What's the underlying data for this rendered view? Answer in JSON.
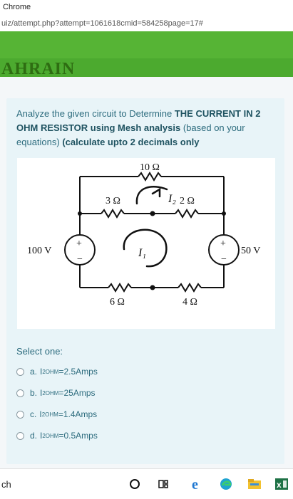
{
  "browser": {
    "title": "Chrome",
    "url": "uiz/attempt.php?attempt=1061618cmid=584258page=17#"
  },
  "banner": {
    "text": "AHRAIN"
  },
  "question": {
    "text_plain": "Analyze the given circuit to Determine ",
    "text_bold_1": "THE CURRENT IN 2 OHM RESISTOR using Mesh analysis",
    "text_plain_2": " (based on your equations) ",
    "text_bold_2": "(calculate upto 2 decimals only"
  },
  "circuit": {
    "r_top": "10 Ω",
    "r_mid_left": "3 Ω",
    "r_mid_right": "2 Ω",
    "r_bottom_left": "6 Ω",
    "r_bottom_right": "4 Ω",
    "source_left": "100 V",
    "source_right": "50 V",
    "plus": "+",
    "minus": "−",
    "mesh_label_1": "I₁",
    "mesh_label_2": "I₂"
  },
  "answer": {
    "prompt": "Select one:",
    "options": [
      {
        "letter": "a.",
        "prefix": "I",
        "sub": "2OHM",
        "value": "=2.5Amps"
      },
      {
        "letter": "b.",
        "prefix": "I",
        "sub": "2OHM",
        "value": "=25Amps"
      },
      {
        "letter": "c.",
        "prefix": "I",
        "sub": "2OHM",
        "value": "=1.4Amps"
      },
      {
        "letter": "d.",
        "prefix": "I",
        "sub": "2OHM",
        "value": "=0.5Amps"
      }
    ]
  },
  "taskbar": {
    "search_text": "ch",
    "icons": [
      "cortana-icon",
      "task-view-icon",
      "edge-legacy-icon",
      "edge-icon",
      "file-explorer-icon",
      "excel-icon"
    ]
  },
  "colors": {
    "banner": "#56b435",
    "question_text": "#2d6c7e",
    "card_bg": "#e8f4f8"
  }
}
